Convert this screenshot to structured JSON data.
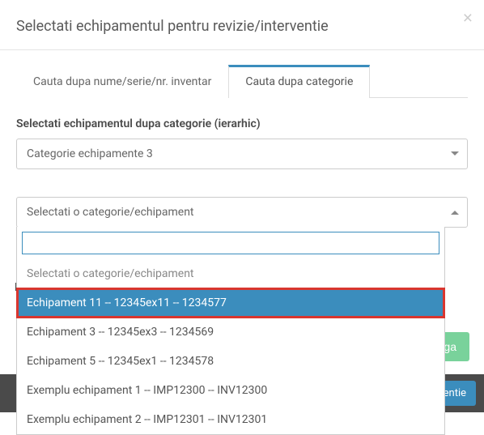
{
  "modal": {
    "title": "Selectati echipamentul pentru revizie/interventie",
    "close_label": "×"
  },
  "tabs": {
    "by_name": "Cauta dupa nume/serie/nr. inventar",
    "by_category": "Cauta dupa categorie"
  },
  "section1": {
    "label": "Selectati echipamentul dupa categorie (ierarhic)",
    "selected": "Categorie echipamente 3"
  },
  "section2": {
    "selected": "Selectati o categorie/echipament",
    "search_value": "",
    "options": [
      {
        "label": "Selectati o categorie/echipament",
        "placeholder": true,
        "highlight": false
      },
      {
        "label": "Echipament 11 -- 12345ex11 -- 1234577",
        "placeholder": false,
        "highlight": true
      },
      {
        "label": "Echipament 3 -- 12345ex3 -- 1234569",
        "placeholder": false,
        "highlight": false
      },
      {
        "label": "Echipament 5 -- 12345ex1 -- 1234578",
        "placeholder": false,
        "highlight": false
      },
      {
        "label": "Exemplu echipament 1 -- IMP12300 -- INV12300",
        "placeholder": false,
        "highlight": false
      },
      {
        "label": "Exemplu echipament 2 -- IMP12301 -- INV12301",
        "placeholder": false,
        "highlight": false
      }
    ]
  },
  "background": {
    "partial_label_prefix": "E",
    "add_button": "Adauga",
    "strip_button_fragment": "/interventie"
  }
}
